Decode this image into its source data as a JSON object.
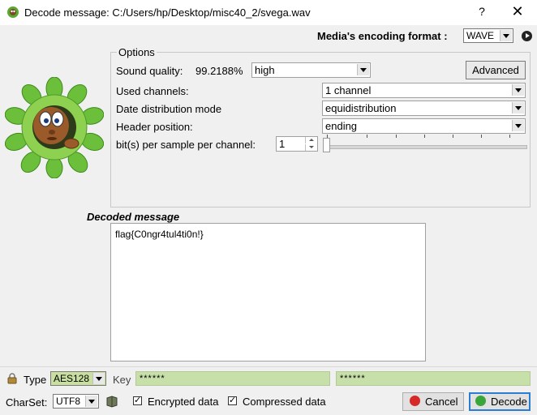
{
  "window": {
    "title": "Decode message: C:/Users/hp/Desktop/misc40_2/svega.wav",
    "help_label": "?",
    "close_label": "✕"
  },
  "format": {
    "label": "Media's encoding format :",
    "value": "WAVE"
  },
  "options": {
    "legend": "Options",
    "sound_quality_label": "Sound quality:",
    "sound_quality_percent": "99.2188%",
    "sound_quality_value": "high",
    "advanced_label": "Advanced",
    "used_channels_label": "Used channels:",
    "used_channels_value": "1 channel",
    "date_distribution_label": "Date distribution mode",
    "date_distribution_value": "equidistribution",
    "header_position_label": "Header position:",
    "header_position_value": "ending",
    "bits_label": "bit(s) per sample per channel:",
    "bits_value": "1"
  },
  "decoded": {
    "label": "Decoded message",
    "text": "flag{C0ngr4tul4ti0n!}"
  },
  "crypto": {
    "type_label": "Type",
    "type_value": "AES128",
    "key_label": "Key",
    "key_value": "******",
    "key_confirm_value": "******",
    "charset_label": "CharSet:",
    "charset_value": "UTF8",
    "encrypted_label": "Encrypted data",
    "encrypted_checked": "✓",
    "compressed_label": "Compressed data",
    "compressed_checked": "✓"
  },
  "buttons": {
    "cancel_label": "Cancel",
    "decode_label": "Decode"
  },
  "colors": {
    "accent": "#2b7cd3",
    "key_field_bg": "#c7dfa9",
    "type_select_bg": "#c9dfa0",
    "mascot_leaf": "#6cbf3a"
  },
  "icons": {
    "app": "leaf-app-icon",
    "play": "play-icon",
    "lock": "lock-icon",
    "book": "book-icon",
    "cancel": "cancel-icon",
    "decode": "decode-check-icon",
    "mascot": "mascot-face-in-leaves"
  }
}
